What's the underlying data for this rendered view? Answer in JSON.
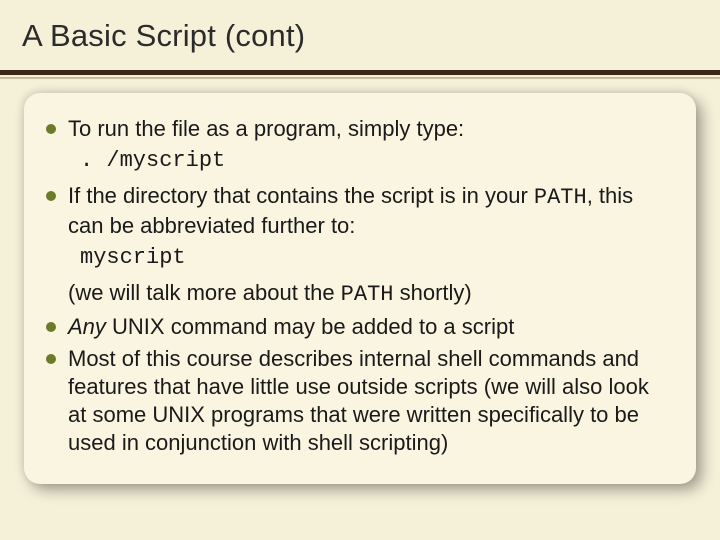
{
  "title": "A Basic Script (cont)",
  "bullets": {
    "b1": {
      "text": "To run the file as a program, simply type:",
      "code": ". /myscript"
    },
    "b2": {
      "pre": "If the directory that contains the script is in your ",
      "path": "PATH",
      "post": ", this can be abbreviated further to:",
      "code": "myscript",
      "note_pre": "(we will talk more about the ",
      "note_path": "PATH",
      "note_post": " shortly)"
    },
    "b3": {
      "any": "Any",
      "rest": " UNIX command may be added to a script"
    },
    "b4": {
      "text": "Most of this course describes internal shell commands and features that have little use outside scripts (we will also look at some UNIX programs that were written specifically to be used in conjunction with shell scripting)"
    }
  }
}
